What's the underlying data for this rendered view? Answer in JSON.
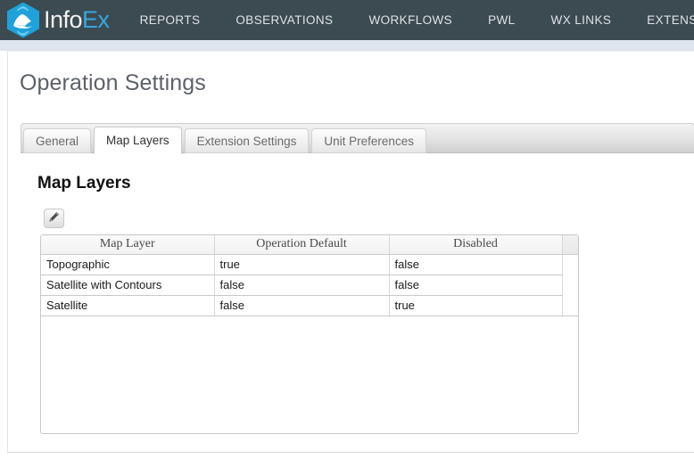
{
  "navbar": {
    "logo": {
      "icon": "infoex-hexagon-mountain-logo",
      "text_primary": "Info",
      "text_secondary": "Ex"
    },
    "items": [
      {
        "label": "REPORTS"
      },
      {
        "label": "OBSERVATIONS"
      },
      {
        "label": "WORKFLOWS"
      },
      {
        "label": "PWL"
      },
      {
        "label": "WX LINKS"
      },
      {
        "label": "EXTENSIONS"
      }
    ],
    "background_color": "#3c4a52",
    "accent_color": "#35a8df"
  },
  "page": {
    "title": "Operation Settings"
  },
  "tabs": [
    {
      "label": "General",
      "active": false
    },
    {
      "label": "Map Layers",
      "active": true
    },
    {
      "label": "Extension Settings",
      "active": false
    },
    {
      "label": "Unit Preferences",
      "active": false
    }
  ],
  "panel": {
    "section_title": "Map Layers",
    "toolbar": {
      "edit_button": {
        "icon": "pencil-icon",
        "title": "Edit"
      }
    },
    "grid": {
      "columns": [
        "Map Layer",
        "Operation Default",
        "Disabled",
        ""
      ],
      "rows": [
        {
          "map_layer": "Topographic",
          "operation_default": "true",
          "disabled": "false"
        },
        {
          "map_layer": "Satellite with Contours",
          "operation_default": "false",
          "disabled": "false"
        },
        {
          "map_layer": "Satellite",
          "operation_default": "false",
          "disabled": "true"
        }
      ]
    }
  }
}
